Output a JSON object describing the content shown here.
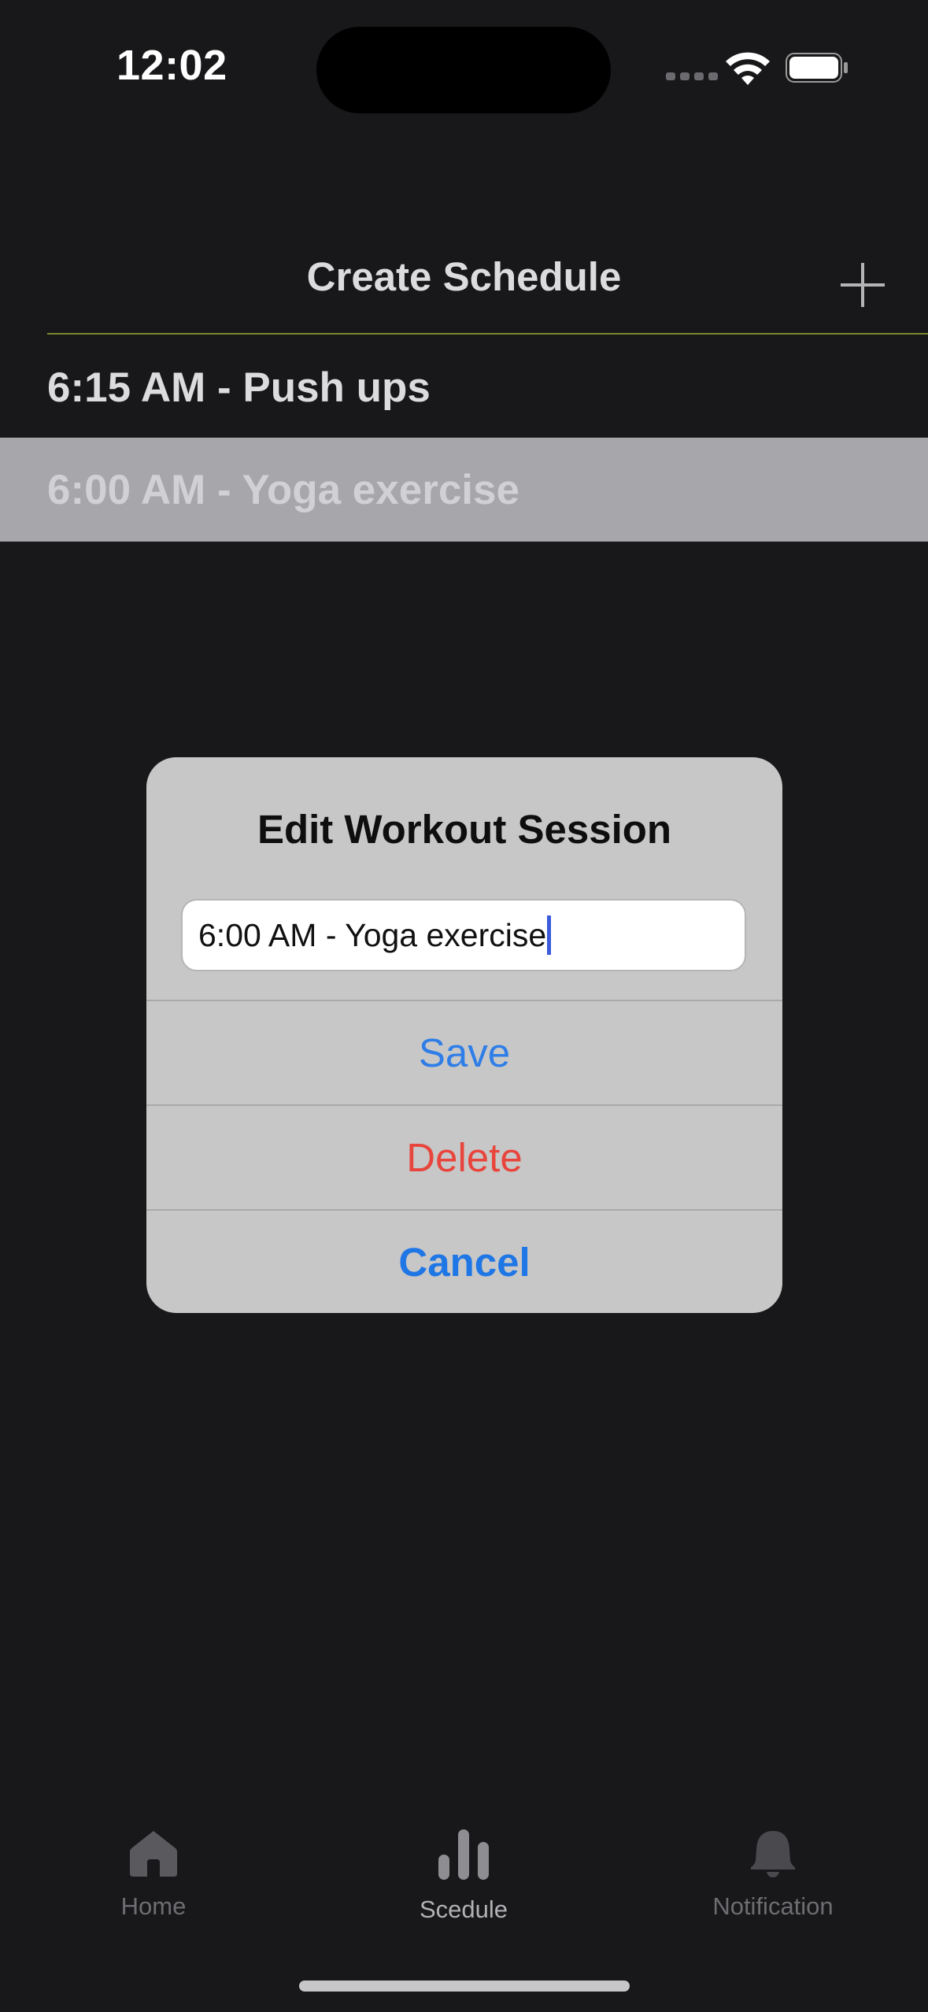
{
  "status_bar": {
    "time": "12:02"
  },
  "header": {
    "title": "Create Schedule",
    "add_icon": "plus-icon"
  },
  "schedule_list": [
    {
      "label": "6:15 AM - Push ups",
      "selected": false
    },
    {
      "label": "6:00 AM - Yoga exercise",
      "selected": true
    }
  ],
  "dialog": {
    "title": "Edit Workout Session",
    "input_value": "6:00 AM - Yoga exercise",
    "save_label": "Save",
    "delete_label": "Delete",
    "cancel_label": "Cancel"
  },
  "tab_bar": {
    "tabs": [
      {
        "label": "Home",
        "icon": "house-icon",
        "active": false
      },
      {
        "label": "Scedule",
        "icon": "bar-chart-icon",
        "active": true
      },
      {
        "label": "Notification",
        "icon": "bell-icon",
        "active": false
      }
    ]
  },
  "colors": {
    "background": "#18181a",
    "selected_row": "#a7a6ab",
    "dialog_bg": "#c7c7c7",
    "save_blue": "#2f7ee8",
    "delete_red": "#e8453c",
    "divider": "#7d8a2a"
  }
}
